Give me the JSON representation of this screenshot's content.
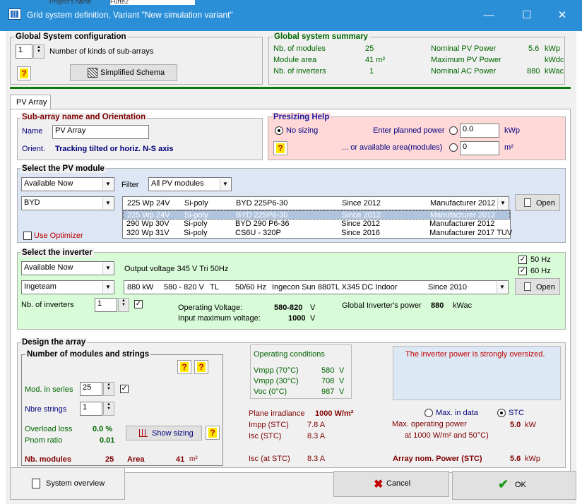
{
  "window": {
    "behind_label": "Project's name",
    "behind_value": "Furte2",
    "title": "Grid system definition, Variant  \"New simulation variant\""
  },
  "global_config": {
    "title": "Global System configuration",
    "num_kinds": "1",
    "num_kinds_label": "Number of kinds of sub-arrays",
    "schema_btn": "Simplified Schema"
  },
  "summary": {
    "title": "Global system summary",
    "rows": [
      {
        "label": "Nb. of modules",
        "value": "25",
        "label2": "Nominal PV Power",
        "value2": "5.6",
        "unit2": "kWp"
      },
      {
        "label": "Module area",
        "value": "41 m²",
        "label2": "Maximum PV Power",
        "value2": "",
        "unit2": "kWdc"
      },
      {
        "label": "Nb. of inverters",
        "value": "1",
        "label2": "Nominal AC Power",
        "value2": "880",
        "unit2": "kWac"
      }
    ]
  },
  "tab": {
    "label": "PV Array"
  },
  "subarray": {
    "title": "Sub-array name and Orientation",
    "name_label": "Name",
    "name_value": "PV Array",
    "orient_label": "Orient.",
    "orient_value": "Tracking tilted or horiz. N-S axis"
  },
  "presizing": {
    "title": "Presizing Help",
    "no_sizing": "No sizing",
    "planned_label": "Enter planned power",
    "planned_value": "0.0",
    "planned_unit": "kWp",
    "area_label": "...  or available area(modules)",
    "area_value": "0",
    "area_unit": "m²"
  },
  "pvmodule": {
    "title": "Select the PV module",
    "availability": "Available Now",
    "filter_label": "Filter",
    "filter_value": "All PV modules",
    "manufacturer": "BYD",
    "use_optimizer": "Use Optimizer",
    "open_btn": "Open",
    "selected": {
      "c1": "225 Wp 24V",
      "c2": "Si-poly",
      "c3": "BYD 225P6-30",
      "c4": "Since 2012",
      "c5": "Manufacturer 2012"
    },
    "list": [
      {
        "c1": "225 Wp 24V",
        "c2": "Si-poly",
        "c3": "BYD 225P6-30",
        "c4": "Since 2012",
        "c5": "Manufacturer 2012"
      },
      {
        "c1": "290 Wp 30V",
        "c2": "Si-poly",
        "c3": "BYD 290 P6-36",
        "c4": "Since 2012",
        "c5": "Manufacturer 2012"
      },
      {
        "c1": "320 Wp 31V",
        "c2": "Si-poly",
        "c3": "CS6U - 320P",
        "c4": "Since 2016",
        "c5": "Manufacturer 2017 TUV"
      }
    ]
  },
  "inverter": {
    "title": "Select the inverter",
    "availability": "Available Now",
    "output_voltage": "Output voltage 345 V Tri 50Hz",
    "hz50": "50 Hz",
    "hz60": "60 Hz",
    "manufacturer": "Ingeteam",
    "selected": {
      "c1": "880 kW",
      "c2": "580 - 820 V",
      "c3": "TL",
      "c4": "50/60 Hz",
      "c5": "Ingecon Sun 880TL X345 DC Indoor",
      "c6": "Since 2010"
    },
    "open_btn": "Open",
    "nb_label": "Nb. of inverters",
    "nb_value": "1",
    "op_voltage_label": "Operating Voltage:",
    "op_voltage_value": "580-820",
    "op_voltage_unit": "V",
    "max_voltage_label": "Input maximum voltage:",
    "max_voltage_value": "1000",
    "max_voltage_unit": "V",
    "global_power_label": "Global Inverter's power",
    "global_power_value": "880",
    "global_power_unit": "kWac"
  },
  "design": {
    "title": "Design the array",
    "mods_title": "Number of modules and strings",
    "mod_series_label": "Mod. in series",
    "mod_series_value": "25",
    "strings_label": "Nbre strings",
    "strings_value": "1",
    "overload_label": "Overload loss",
    "overload_value": "0.0 %",
    "pnom_label": "Pnom ratio",
    "pnom_value": "0.01",
    "show_sizing_btn": "Show sizing",
    "nb_modules_label": "Nb. modules",
    "nb_modules_value": "25",
    "area_label": "Area",
    "area_value": "41",
    "area_unit": "m²",
    "opcond": {
      "title": "Operating conditions",
      "rows": [
        {
          "label": "Vmpp (70°C)",
          "value": "580",
          "unit": "V"
        },
        {
          "label": "Vmpp (30°C)",
          "value": "708",
          "unit": "V"
        },
        {
          "label": "Voc  (0°C)",
          "value": "987",
          "unit": "V"
        }
      ]
    },
    "warning": "The inverter power is strongly oversized.",
    "plane_irr_label": "Plane irradiance",
    "plane_irr_value": "1000 W/m²",
    "impp_label": "Impp (STC)",
    "impp_value": "7.8 A",
    "isc_label": "Isc  (STC)",
    "isc_value": "8.3 A",
    "isc_at_label": "Isc (at STC)",
    "isc_at_value": "8.3 A",
    "max_in_data": "Max. in data",
    "stc": "STC",
    "max_op_label": "Max. operating power",
    "max_op_value": "5.0",
    "max_op_unit": "kW",
    "max_op_sub": "at 1000 W/m²  and 50°C)",
    "array_nom_label": "Array nom. Power (STC)",
    "array_nom_value": "5.6",
    "array_nom_unit": "kWp"
  },
  "bottom": {
    "overview_btn": "System overview",
    "cancel_btn": "Cancel",
    "ok_btn": "OK"
  },
  "colors": {
    "titlebar": "#2b8fd8",
    "pvmodule_bg": "#dce6f5",
    "inverter_bg": "#d8fbd8",
    "presizing_bg": "#ffd8d8",
    "warning_bg": "#dde8f5"
  }
}
